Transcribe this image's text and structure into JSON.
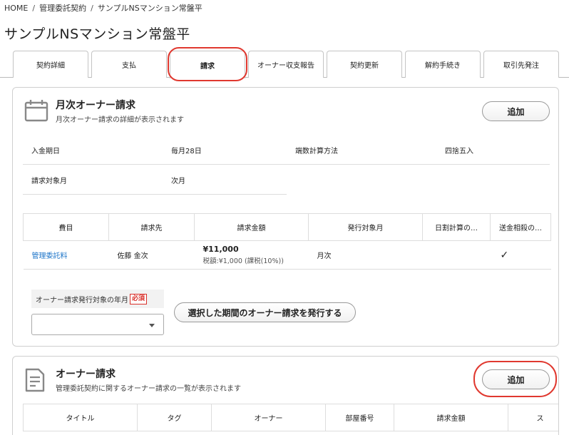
{
  "breadcrumb": {
    "home": "HOME",
    "sep": "/",
    "level1": "管理委託契約",
    "level2": "サンプルNSマンション常盤平"
  },
  "page_title": "サンプルNSマンション常盤平",
  "tabs": [
    {
      "label": "契約詳細"
    },
    {
      "label": "支払"
    },
    {
      "label": "請求",
      "active": true
    },
    {
      "label": "オーナー収支報告"
    },
    {
      "label": "契約更新"
    },
    {
      "label": "解約手続き"
    },
    {
      "label": "取引先発注"
    }
  ],
  "monthly_card": {
    "title": "月次オーナー請求",
    "subtitle": "月次オーナー請求の詳細が表示されます",
    "add_label": "追加",
    "icon": "calendar-icon",
    "fields": {
      "deposit_day_label": "入金期日",
      "deposit_day_value": "毎月28日",
      "rounding_label": "端数計算方法",
      "rounding_value": "四捨五入",
      "target_month_label": "請求対象月",
      "target_month_value": "次月"
    },
    "table": {
      "headers": [
        "費目",
        "請求先",
        "請求金額",
        "発行対象月",
        "日割計算の…",
        "送金相殺の…"
      ],
      "rows": [
        {
          "item": "管理委託料",
          "bill_to": "佐藤 金次",
          "amount": "¥11,000",
          "amount_sub": "税額:¥1,000 (課税(10%))",
          "issue_month": "月次",
          "prorate": "",
          "offset": "✓"
        }
      ]
    },
    "issue_field_label": "オーナー請求発行対象の年月",
    "required_label": "必須",
    "issue_select_value": "",
    "issue_button_label": "選択した期間のオーナー請求を発行する"
  },
  "owner_card": {
    "title": "オーナー請求",
    "subtitle": "管理委託契約に関するオーナー請求の一覧が表示されます",
    "add_label": "追加",
    "icon": "document-icon",
    "table": {
      "headers": [
        "タイトル",
        "タグ",
        "オーナー",
        "部屋番号",
        "請求金額",
        "ス"
      ]
    }
  },
  "colors": {
    "highlight_ring": "#e0382f",
    "link": "#1a73c8",
    "required": "#d9302a"
  }
}
